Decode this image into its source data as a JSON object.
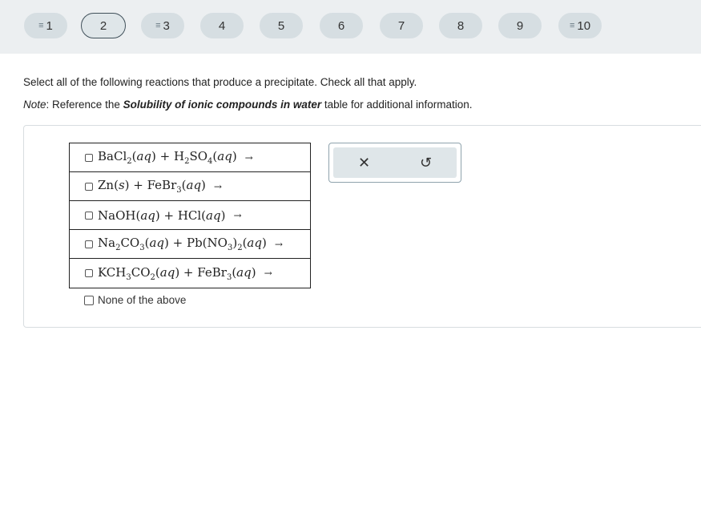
{
  "question_nav": [
    {
      "label": "1",
      "has_lines": true
    },
    {
      "label": "2",
      "has_lines": false,
      "current": true
    },
    {
      "label": "3",
      "has_lines": true
    },
    {
      "label": "4",
      "has_lines": false
    },
    {
      "label": "5",
      "has_lines": false
    },
    {
      "label": "6",
      "has_lines": false
    },
    {
      "label": "7",
      "has_lines": false
    },
    {
      "label": "8",
      "has_lines": false
    },
    {
      "label": "9",
      "has_lines": false
    },
    {
      "label": "10",
      "has_lines": true
    }
  ],
  "question": {
    "prompt": "Select all of the following reactions that produce a precipitate. Check all that apply.",
    "note_prefix": "Note",
    "note_mid": ": Reference the ",
    "note_link": "Solubility of ionic compounds in water",
    "note_suffix": " table for additional information."
  },
  "choices": [
    {
      "html": "BaCl<sub>2</sub>(<span class='it'>aq</span>) + H<sub>2</sub>SO<sub>4</sub>(<span class='it'>aq</span>)"
    },
    {
      "html": "Zn(<span class='it'>s</span>) + FeBr<sub>3</sub>(<span class='it'>aq</span>)"
    },
    {
      "html": "NaOH(<span class='it'>aq</span>) + HCl(<span class='it'>aq</span>)"
    },
    {
      "html": "Na<sub>2</sub>CO<sub>3</sub>(<span class='it'>aq</span>) + Pb(NO<sub>3</sub>)<sub>2</sub>(<span class='it'>aq</span>)"
    },
    {
      "html": "KCH<sub>3</sub>CO<sub>2</sub>(<span class='it'>aq</span>) + FeBr<sub>3</sub>(<span class='it'>aq</span>)"
    }
  ],
  "arrow": "→",
  "none_label": "None of the above",
  "tools": {
    "clear_icon": "✕",
    "undo_icon": "↺"
  }
}
